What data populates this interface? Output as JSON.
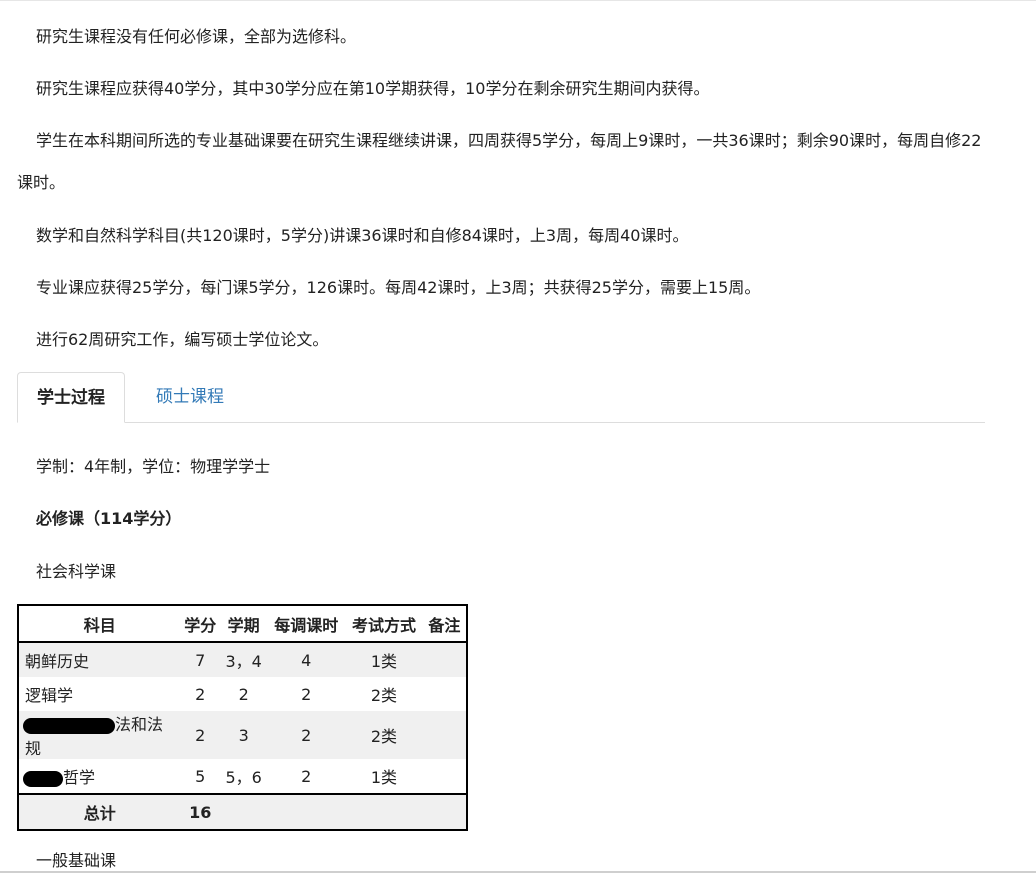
{
  "paragraphs": [
    "研究生课程没有任何必修课，全部为选修科。",
    "研究生课程应获得40学分，其中30学分应在第10学期获得，10学分在剩余研究生期间内获得。",
    "学生在本科期间所选的专业基础课要在研究生课程继续讲课，四周获得5学分，每周上9课时，一共36课时；剩余90课时，每周自修22课时。",
    "数学和自然科学科目(共120课时，5学分)讲课36课时和自修84课时，上3周，每周40课时。",
    "专业课应获得25学分，每门课5学分，126课时。每周42课时，上3周；共获得25学分，需要上15周。",
    "进行62周研究工作，编写硕士学位论文。"
  ],
  "tabs": [
    {
      "label": "学士过程",
      "active": true
    },
    {
      "label": "硕士课程",
      "active": false
    }
  ],
  "bachelor": {
    "system": "学制：4年制，学位：物理学学士",
    "required_heading": "必修课（114学分）",
    "social_heading": "社会科学课",
    "general_heading": "一般基础课"
  },
  "table": {
    "headers": [
      "科目",
      "学分",
      "学期",
      "每调课时",
      "考试方式",
      "备注"
    ],
    "rows": [
      {
        "name": "朝鲜历史",
        "credits": "7",
        "term": "3，4",
        "hours": "4",
        "exam": "1类",
        "note": ""
      },
      {
        "name": "逻辑学",
        "credits": "2",
        "term": "2",
        "hours": "2",
        "exam": "2类",
        "note": ""
      },
      {
        "name": "法和法规",
        "credits": "2",
        "term": "3",
        "hours": "2",
        "exam": "2类",
        "note": ""
      },
      {
        "name": "哲学",
        "credits": "5",
        "term": "5，6",
        "hours": "2",
        "exam": "1类",
        "note": ""
      }
    ],
    "total_label": "总计",
    "total_credits": "16"
  }
}
